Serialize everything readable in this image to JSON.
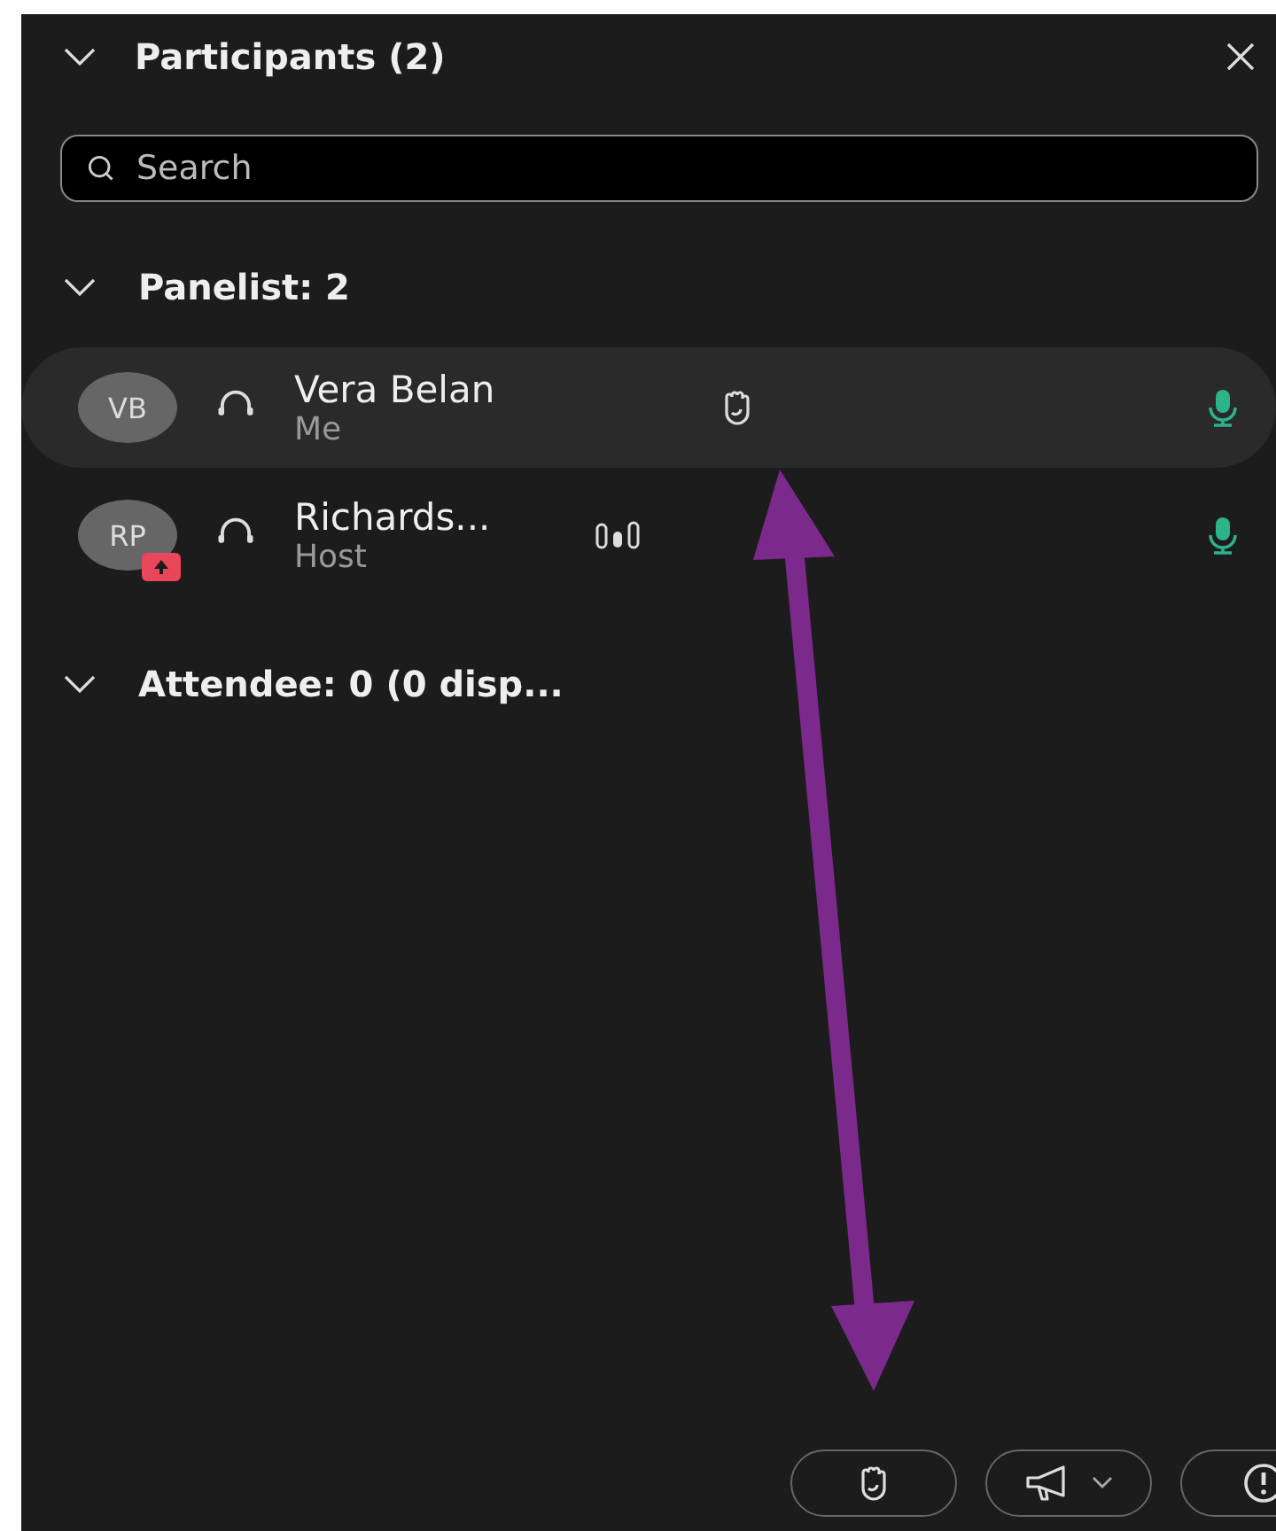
{
  "panel": {
    "title": "Participants (2)",
    "expanded": true
  },
  "search": {
    "placeholder": "Search"
  },
  "sections": [
    {
      "title": "Panelist: 2",
      "expanded": true,
      "participants": [
        {
          "initials": "VB",
          "name": "Vera Belan",
          "role": "Me",
          "selected": true,
          "sharing": false,
          "speaking": false,
          "hand_raised": true
        },
        {
          "initials": "RP",
          "name": "Richards...",
          "role": "Host",
          "selected": false,
          "sharing": true,
          "speaking": true,
          "hand_raised": false
        }
      ]
    },
    {
      "title": "Attendee: 0 (0 disp...",
      "expanded": true
    }
  ],
  "footer_buttons": [
    {
      "kind": "hand"
    },
    {
      "kind": "announce"
    },
    {
      "kind": "info"
    }
  ]
}
